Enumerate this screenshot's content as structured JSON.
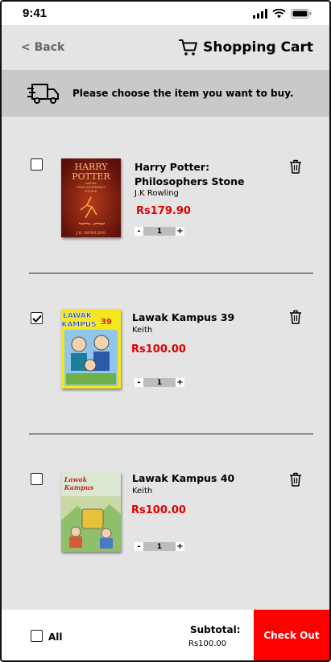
{
  "status_bar": {
    "time": "9:41"
  },
  "header": {
    "back_label": "< Back",
    "title": "Shopping Cart"
  },
  "banner": {
    "text": "Please choose the item you want to buy."
  },
  "items": [
    {
      "title_line1": "Harry Potter:",
      "title_line2": "Philosophers Stone",
      "author": "J.K Rowling",
      "price": "Rs179.90",
      "quantity": "1",
      "checked": false,
      "cover": {
        "title_top": "HARRY",
        "title_bottom": "POTTER",
        "subtitle_top": "and the",
        "subtitle_mid": "PHILOSOPHER'S",
        "subtitle_bottom": "STONE",
        "author": "J.K. ROWLING"
      }
    },
    {
      "title_line1": "Lawak Kampus 39",
      "author": "Keith",
      "price": "Rs100.00",
      "quantity": "1",
      "checked": true,
      "cover": {
        "title_top": "LAWAK",
        "title_bottom": "KAMPUS",
        "number": "39"
      }
    },
    {
      "title_line1": "Lawak Kampus 40",
      "author": "Keith",
      "price": "Rs100.00",
      "quantity": "1",
      "checked": false,
      "cover": {
        "title_top": "Lawak",
        "title_bottom": "Kampus"
      }
    }
  ],
  "qty_controls": {
    "minus": "-",
    "plus": "+"
  },
  "footer": {
    "select_all_label": "All",
    "subtotal_label": "Subtotal:",
    "subtotal_value": "Rs100.00",
    "checkout_label": "Check Out"
  },
  "colors": {
    "price": "#e00000",
    "checkout": "#ff0000",
    "background": "#e4e4e4",
    "banner": "#c9c9c9"
  },
  "icons": [
    "signal-icon",
    "wifi-icon",
    "battery-icon",
    "cart-icon",
    "delivery-truck-icon",
    "trash-icon",
    "checkmark-icon"
  ]
}
